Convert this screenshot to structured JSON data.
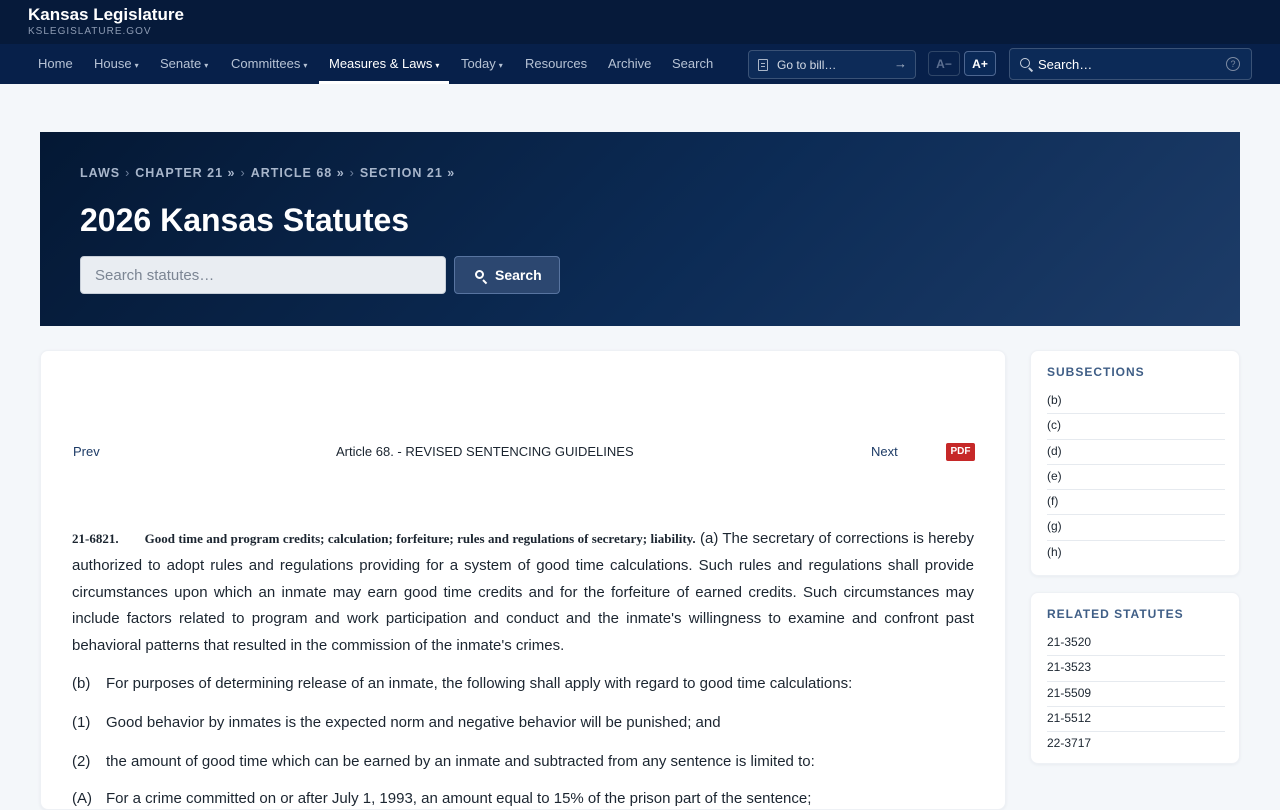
{
  "brand": {
    "title": "Kansas Legislature",
    "subtitle": "KSLEGISLATURE.GOV"
  },
  "nav": {
    "items": [
      {
        "label": "Home",
        "caret": ""
      },
      {
        "label": "House",
        "caret": "▾"
      },
      {
        "label": "Senate",
        "caret": "▾"
      },
      {
        "label": "Committees",
        "caret": "▾"
      },
      {
        "label": "Measures & Laws",
        "caret": "▾",
        "active": true
      },
      {
        "label": "Today",
        "caret": "▾"
      },
      {
        "label": "Resources",
        "caret": ""
      },
      {
        "label": "Archive",
        "caret": ""
      },
      {
        "label": "Search",
        "caret": ""
      }
    ],
    "goto_label": "Go to bill…",
    "font_decrease": "A−",
    "font_increase": "A+",
    "search_placeholder": "Search…",
    "help_glyph": "?"
  },
  "hero": {
    "breadcrumb": [
      "LAWS",
      "CHAPTER 21 »",
      "ARTICLE 68 »",
      "SECTION 21 »"
    ],
    "title": "2026 Kansas Statutes",
    "search_placeholder": "Search statutes…",
    "search_button": "Search"
  },
  "article_nav": {
    "prev": "Prev",
    "title": "Article 68. - REVISED SENTENCING GUIDELINES",
    "next": "Next",
    "pdf": "PDF"
  },
  "statute": {
    "number": "21-6821.",
    "heading": "Good time and program credits; calculation; forfeiture; rules and regulations of secretary; liability.",
    "text_a": "(a) The secretary of corrections is hereby authorized to adopt rules and regulations providing for a system of good time calculations. Such rules and regulations shall provide circumstances upon which an inmate may earn good time credits and for the forfeiture of earned credits. Such circumstances may include factors related to program and work participation and conduct and the inmate's willingness to examine and confront past behavioral patterns that resulted in the commission of the inmate's crimes.",
    "paragraphs": [
      {
        "mark": "(b)",
        "text": "For purposes of determining release of an inmate, the following shall apply with regard to good time calculations:"
      },
      {
        "mark": "(1)",
        "text": "Good behavior by inmates is the expected norm and negative behavior will be punished; and"
      },
      {
        "mark": "(2)",
        "text": "the amount of good time which can be earned by an inmate and subtracted from any sentence is limited to:"
      },
      {
        "mark": "(A)",
        "text": "For a crime committed on or after July 1, 1993, an amount equal to 15% of the prison part of the sentence;"
      }
    ]
  },
  "sidebar": {
    "subsections_title": "SUBSECTIONS",
    "subsections": [
      "(b)",
      "(c)",
      "(d)",
      "(e)",
      "(f)",
      "(g)",
      "(h)"
    ],
    "related_title": "RELATED STATUTES",
    "related": [
      "21-3520",
      "21-3523",
      "21-5509",
      "21-5512",
      "22-3717"
    ]
  }
}
